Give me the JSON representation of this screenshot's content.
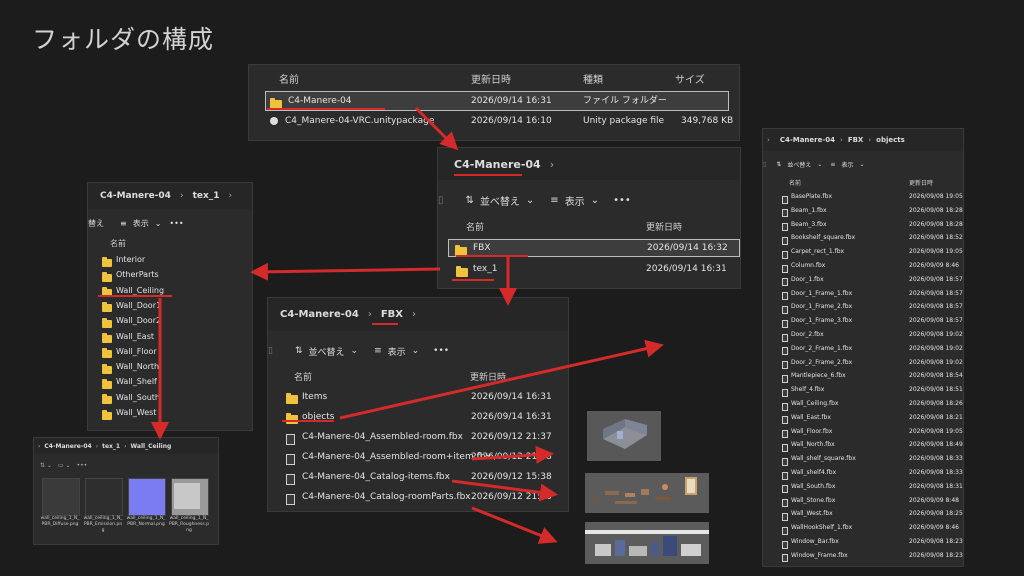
{
  "slide_title": "フォルダの構成",
  "panel_root": {
    "headers": {
      "name": "名前",
      "modified": "更新日時",
      "type": "種類",
      "size": "サイズ"
    },
    "rows": [
      {
        "name": "C4-Manere-04",
        "date": "2026/09/14 16:31",
        "type": "ファイル フォルダー",
        "size": ""
      },
      {
        "name": "C4_Manere-04-VRC.unitypackage",
        "date": "2026/09/14 16:10",
        "type": "Unity package file",
        "size": "349,768 KB"
      }
    ]
  },
  "panel_c4": {
    "path": [
      "C4-Manere-04"
    ],
    "toolbar": {
      "sort": "並べ替え",
      "view": "表示",
      "more": "•••"
    },
    "headers": {
      "name": "名前",
      "modified": "更新日時"
    },
    "rows": [
      {
        "name": "FBX",
        "date": "2026/09/14 16:32"
      },
      {
        "name": "tex_1",
        "date": "2026/09/14 16:31"
      }
    ]
  },
  "panel_tex": {
    "path": [
      "C4-Manere-04",
      "tex_1"
    ],
    "toolbar": {
      "sort": "替え",
      "view": "表示",
      "more": "•••"
    },
    "header_name": "名前",
    "folders": [
      "Interior",
      "OtherParts",
      "Wall_Ceiling",
      "Wall_Door1",
      "Wall_Door2",
      "Wall_East",
      "Wall_Floor",
      "Wall_North",
      "Wall_Shelf",
      "Wall_South",
      "Wall_West"
    ]
  },
  "panel_fbx": {
    "path": [
      "C4-Manere-04",
      "FBX"
    ],
    "toolbar": {
      "sort": "並べ替え",
      "view": "表示",
      "more": "•••"
    },
    "headers": {
      "name": "名前",
      "modified": "更新日時"
    },
    "folders": [
      {
        "name": "Items",
        "date": "2026/09/14 16:31"
      },
      {
        "name": "objects",
        "date": "2026/09/14 16:31"
      }
    ],
    "files": [
      {
        "name": "C4-Manere-04_Assembled-room.fbx",
        "date": "2026/09/12 21:37"
      },
      {
        "name": "C4-Manere-04_Assembled-room+item.fbx",
        "date": "2026/09/12 21:38"
      },
      {
        "name": "C4-Manere-04_Catalog-items.fbx",
        "date": "2026/09/12 15:38"
      },
      {
        "name": "C4-Manere-04_Catalog-roomParts.fbx",
        "date": "2026/09/12 21:36"
      }
    ]
  },
  "panel_objects": {
    "path": [
      "C4-Manere-04",
      "FBX",
      "objects"
    ],
    "toolbar": {
      "sort": "並べ替え",
      "view": "表示"
    },
    "headers": {
      "name": "名前",
      "modified": "更新日時"
    },
    "files": [
      {
        "name": "BasePlate.fbx",
        "date": "2026/09/08 19:05"
      },
      {
        "name": "Beam_1.fbx",
        "date": "2026/09/08 18:28"
      },
      {
        "name": "Beam_3.fbx",
        "date": "2026/09/08 18:28"
      },
      {
        "name": "Bookshelf_square.fbx",
        "date": "2026/09/08 18:52"
      },
      {
        "name": "Carpet_rect_1.fbx",
        "date": "2026/09/08 19:05"
      },
      {
        "name": "Column.fbx",
        "date": "2026/09/09 8:46"
      },
      {
        "name": "Door_1.fbx",
        "date": "2026/09/08 18:57"
      },
      {
        "name": "Door_1_Frame_1.fbx",
        "date": "2026/09/08 18:57"
      },
      {
        "name": "Door_1_Frame_2.fbx",
        "date": "2026/09/08 18:57"
      },
      {
        "name": "Door_1_Frame_3.fbx",
        "date": "2026/09/08 18:57"
      },
      {
        "name": "Door_2.fbx",
        "date": "2026/09/08 19:02"
      },
      {
        "name": "Door_2_Frame_1.fbx",
        "date": "2026/09/08 19:02"
      },
      {
        "name": "Door_2_Frame_2.fbx",
        "date": "2026/09/08 19:02"
      },
      {
        "name": "Mantlepiece_6.fbx",
        "date": "2026/09/08 18:54"
      },
      {
        "name": "Shelf_4.fbx",
        "date": "2026/09/08 18:51"
      },
      {
        "name": "Wall_Ceiling.fbx",
        "date": "2026/09/08 18:26"
      },
      {
        "name": "Wall_East.fbx",
        "date": "2026/09/08 18:21"
      },
      {
        "name": "Wall_Floor.fbx",
        "date": "2026/09/08 19:05"
      },
      {
        "name": "Wall_North.fbx",
        "date": "2026/09/08 18:49"
      },
      {
        "name": "Wall_shelf_square.fbx",
        "date": "2026/09/08 18:33"
      },
      {
        "name": "Wall_shelf4.fbx",
        "date": "2026/09/08 18:33"
      },
      {
        "name": "Wall_South.fbx",
        "date": "2026/09/08 18:31"
      },
      {
        "name": "Wall_Stone.fbx",
        "date": "2026/09/09 8:48"
      },
      {
        "name": "Wall_West.fbx",
        "date": "2026/09/08 18:25"
      },
      {
        "name": "WallHookShelf_1.fbx",
        "date": "2026/09/09 8:46"
      },
      {
        "name": "Window_Bar.fbx",
        "date": "2026/09/08 18:23"
      },
      {
        "name": "Window_Frame.fbx",
        "date": "2026/09/08 18:23"
      }
    ]
  },
  "panel_ceiling": {
    "path": [
      "C4-Manere-04",
      "tex_1",
      "Wall_Ceiling"
    ],
    "images": [
      {
        "label": "wall_ceiling_1_N_PBR_Diffuse.png",
        "color": "#3a3a3a"
      },
      {
        "label": "wall_ceiling_1_N_PBR_Emission.png",
        "color": "#2e2e2e"
      },
      {
        "label": "wall_ceiling_1_N_PBR_Normal.png",
        "color": "#7b7bf2"
      },
      {
        "label": "wall_ceiling_1_N_PBR_Roughness.png",
        "color": "#9a9a9a"
      }
    ]
  },
  "colors": {
    "accent_red": "#d42a2a",
    "folder_yellow": "#f0c33c",
    "background": "#1c1c1c"
  }
}
